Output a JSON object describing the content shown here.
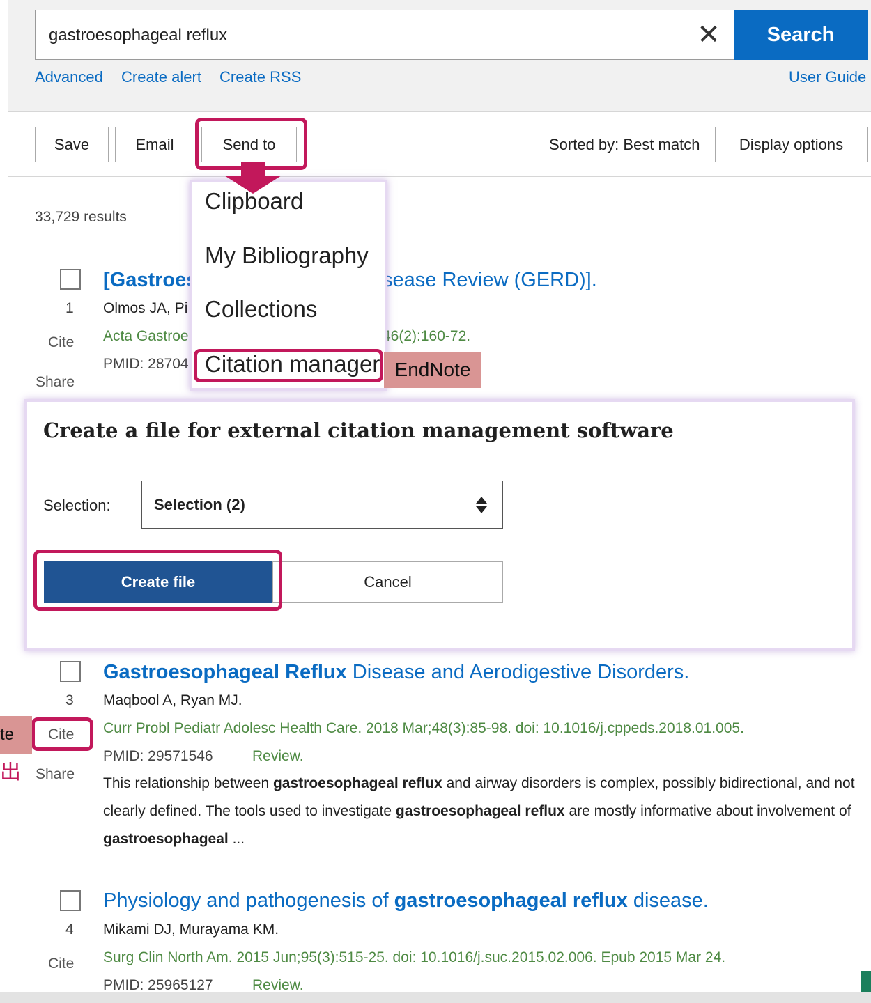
{
  "search": {
    "query": "gastroesophageal reflux",
    "clear_icon": "close-icon",
    "button_label": "Search",
    "links": [
      "Advanced",
      "Create alert",
      "Create RSS"
    ],
    "user_guide": "User Guide"
  },
  "toolbar": {
    "save": "Save",
    "email": "Email",
    "send_to": "Send to",
    "sorted_by": "Sorted by: Best match",
    "display_options": "Display options"
  },
  "send_to_menu": {
    "items": [
      "Clipboard",
      "My Bibliography",
      "Collections",
      "Citation manager"
    ]
  },
  "annotation": {
    "endnote_tag": "EndNote",
    "cut_tag": "te",
    "cut_char": "出"
  },
  "results": {
    "count": "33,729 results",
    "items": [
      {
        "num": "1",
        "title_visible_left": "[Gastroes",
        "title_visible_right": "sease Review (GERD)].",
        "authors": "Olmos JA, Pi",
        "journal_left": "Acta Gastroe",
        "journal_right": "46(2):160-72.",
        "pmid": "PMID: 28704",
        "cite": "Cite",
        "share": "Share"
      },
      {
        "num": "3",
        "title_bold": "Gastroesophageal Reflux",
        "title_rest": " Disease and Aerodigestive Disorders.",
        "authors": "Maqbool A, Ryan MJ.",
        "journal": "Curr Probl Pediatr Adolesc Health Care. 2018 Mar;48(3):85-98. doi: 10.1016/j.cppeds.2018.01.005.",
        "pmid": "PMID: 29571546",
        "type": "Review.",
        "cite": "Cite",
        "share": "Share",
        "snippet": {
          "p1": "This relationship between ",
          "b1": "gastroesophageal reflux",
          "p2": " and airway disorders is complex, possibly bidirectional, and not clearly defined. The tools used to investigate ",
          "b2": "gastroesophageal reflux",
          "p3": " are mostly informative about involvement of ",
          "b3": "gastroesophageal",
          "p4": " ..."
        }
      },
      {
        "num": "4",
        "title_pre": "Physiology and pathogenesis of ",
        "title_bold": "gastroesophageal reflux",
        "title_post": " disease.",
        "authors": "Mikami DJ, Murayama KM.",
        "journal": "Surg Clin North Am. 2015 Jun;95(3):515-25. doi: 10.1016/j.suc.2015.02.006. Epub 2015 Mar 24.",
        "pmid": "PMID: 25965127",
        "type": "Review.",
        "cite": "Cite"
      }
    ]
  },
  "citation_panel": {
    "title": "Create a file for external citation management software",
    "selection_label": "Selection:",
    "selection_value": "Selection (2)",
    "create_file": "Create file",
    "cancel": "Cancel"
  },
  "colors": {
    "brand_blue": "#0a6bc2",
    "highlight_magenta": "#c2185b",
    "tag_pink": "#d99594",
    "create_button": "#205493"
  }
}
